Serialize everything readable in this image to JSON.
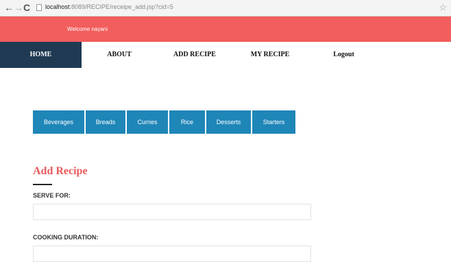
{
  "browser": {
    "url_host": "localhost",
    "url_path": ":8089/RECIPE/receipe_add.jsp?cid=5"
  },
  "welcome": {
    "text": "Welcome nayani"
  },
  "nav": {
    "items": [
      {
        "label": "HOME"
      },
      {
        "label": "ABOUT"
      },
      {
        "label": "ADD RECIPE"
      },
      {
        "label": "MY RECIPE"
      },
      {
        "label": "Logout"
      }
    ]
  },
  "categories": [
    {
      "label": "Beverages"
    },
    {
      "label": "Breads"
    },
    {
      "label": "Curries"
    },
    {
      "label": "Rice"
    },
    {
      "label": "Desserts"
    },
    {
      "label": "Starters"
    }
  ],
  "form": {
    "title": "Add Recipe",
    "serve_for_label": "SERVE FOR:",
    "serve_for_value": "",
    "cooking_duration_label": "COOKING DURATION:",
    "cooking_duration_value": ""
  },
  "colors": {
    "welcome_bar": "#f25d5d",
    "nav_active": "#1f3a52",
    "category_tab": "#1f86b8",
    "title": "#e9595a"
  }
}
